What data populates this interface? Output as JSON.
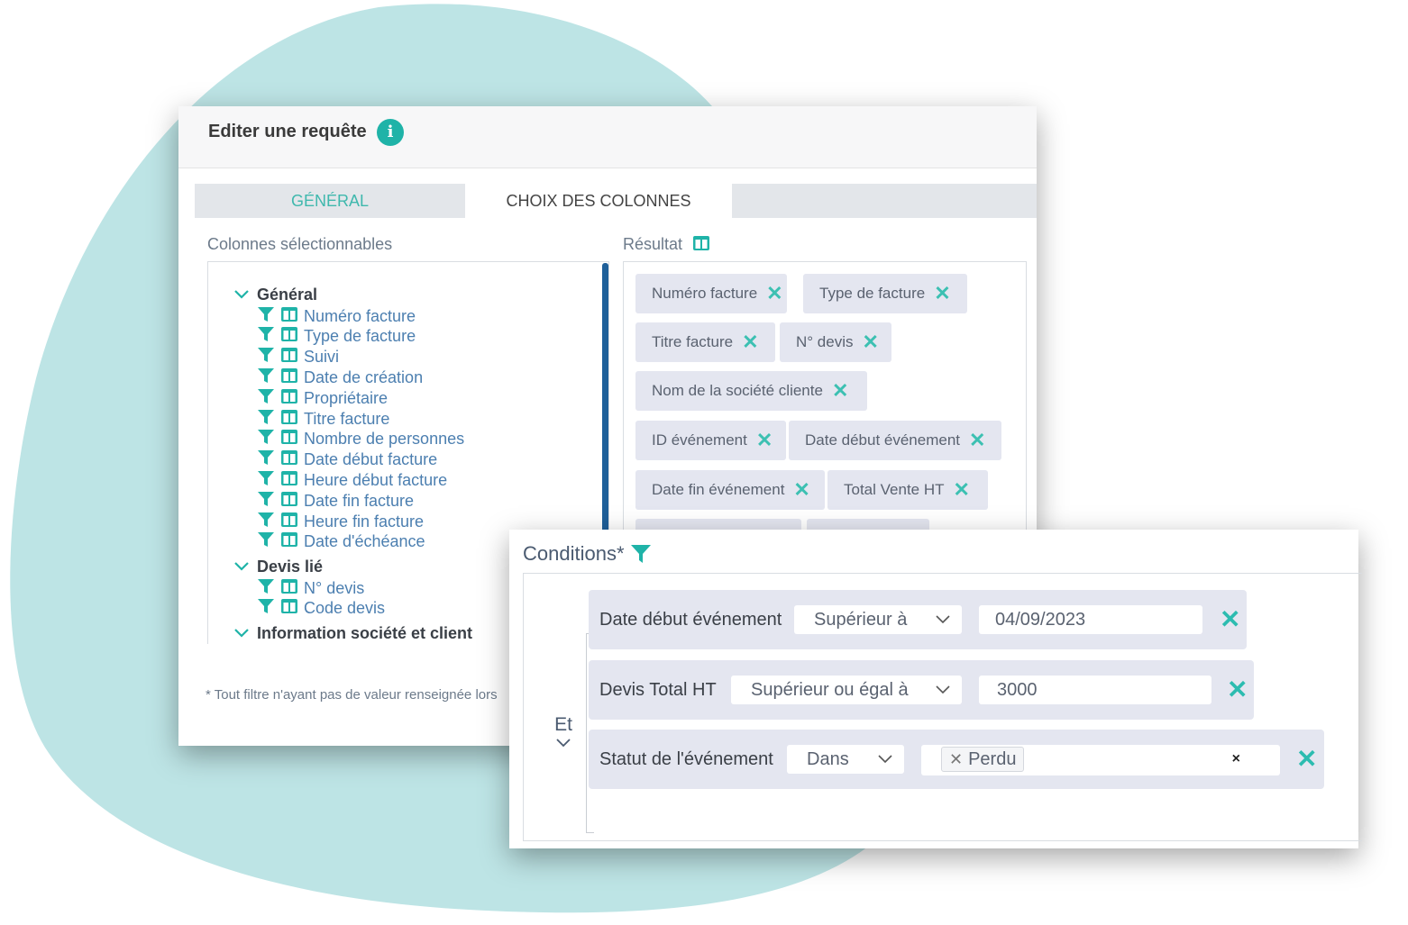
{
  "window": {
    "title": "Editer une requête",
    "tabs": [
      "GÉNÉRAL",
      "CHOIX DES COLONNES"
    ],
    "active_tab": "CHOIX DES COLONNES"
  },
  "left_panel": {
    "label": "Colonnes sélectionnables",
    "groups": [
      {
        "name": "Général",
        "items": [
          "Numéro facture",
          "Type de facture",
          "Suivi",
          "Date de création",
          "Propriétaire",
          "Titre facture",
          "Nombre de personnes",
          "Date début facture",
          "Heure début facture",
          "Date fin facture",
          "Heure fin facture",
          "Date d'échéance"
        ]
      },
      {
        "name": "Devis lié",
        "items": [
          "N° devis",
          "Code devis"
        ]
      },
      {
        "name": "Information société et client",
        "items": []
      }
    ]
  },
  "right_panel": {
    "label": "Résultat",
    "chips": [
      "Numéro facture",
      "Type de facture",
      "Titre facture",
      "N° devis",
      "Nom de la société cliente",
      "ID événement",
      "Date début événement",
      "Date fin événement",
      "Total Vente HT"
    ]
  },
  "footnote": "* Tout filtre n'ayant pas de valeur renseignée lors",
  "conditions": {
    "title": "Conditions*",
    "operator": "Et",
    "rows": [
      {
        "field": "Date début événement",
        "comparator": "Supérieur à",
        "value": "04/09/2023"
      },
      {
        "field": "Devis Total HT",
        "comparator": "Supérieur ou égal à",
        "value": "3000"
      },
      {
        "field": "Statut de l'événement",
        "comparator": "Dans",
        "value": "Perdu"
      }
    ],
    "clear_symbol": "×",
    "remove_symbol": "✕"
  },
  "colors": {
    "accent": "#1fb3a8",
    "link": "#4c7fb0",
    "blob": "#bde4e5",
    "scrollbar": "#1e5f99"
  }
}
